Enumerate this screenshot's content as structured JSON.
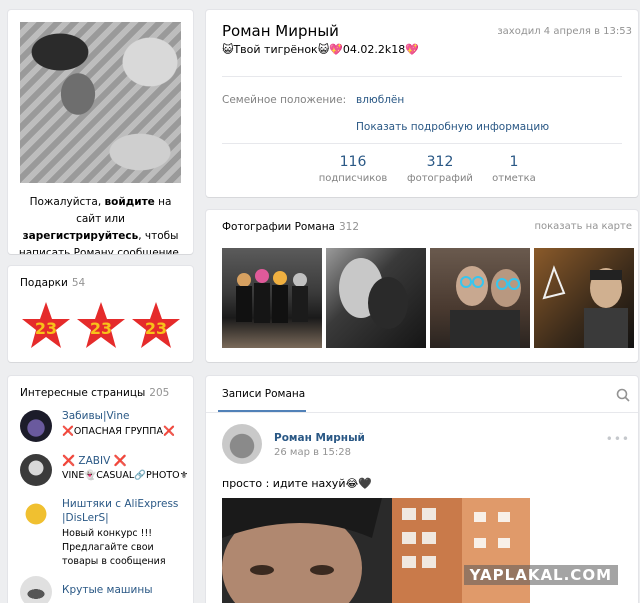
{
  "profile": {
    "name": "Роман Мирный",
    "last_seen": "заходил 4 апреля в 13:53",
    "status": "😺Твой тигрёнок😺💖04.02.2k18💖",
    "relation_label": "Семейное положение:",
    "relation_value": "влюблён",
    "show_more": "Показать подробную информацию",
    "stats": [
      {
        "num": "116",
        "label": "подписчиков"
      },
      {
        "num": "312",
        "label": "фотографий"
      },
      {
        "num": "1",
        "label": "отметка"
      }
    ]
  },
  "avatar_prompt": {
    "part1": "Пожалуйста, ",
    "login": "войдите",
    "part2": " на сайт или ",
    "register": "зарегистрируйтесь",
    "part3": ", чтобы написать Роману сообщение."
  },
  "gifts": {
    "title": "Подарки",
    "count": "54",
    "gift_label": "23"
  },
  "pages": {
    "title": "Интересные страницы",
    "count": "205",
    "items": [
      {
        "name": "Забивы|Vine",
        "desc": "❌ОПАСНАЯ ГРУППА❌",
        "desc2": ""
      },
      {
        "name": "❌ ZABIV ❌",
        "desc": "VINE👻CASUAL🔗PHOTO⚜",
        "desc2": ""
      },
      {
        "name": "Ништяки с AliExpress",
        "name2": "|DisLerS|",
        "desc": "Новый конкурс !!!",
        "desc2": "Предлагайте свои",
        "desc3": "товары в сообщения"
      },
      {
        "name": "Крутые машины",
        "desc": "",
        "desc2": ""
      }
    ]
  },
  "photos": {
    "title": "Фотографии Романа",
    "count": "312",
    "show_map": "показать на карте"
  },
  "wall": {
    "tab": "Записи Романа",
    "post": {
      "author": "Роман Мирный",
      "date": "26 мар в 15:28",
      "text": "просто : идите нахуй😂🖤"
    }
  },
  "watermark": "YAPLAKAL.COM",
  "colors": {
    "link": "#2a5885",
    "accent": "#5181b8",
    "background": "#edeef0",
    "muted": "#939393"
  }
}
